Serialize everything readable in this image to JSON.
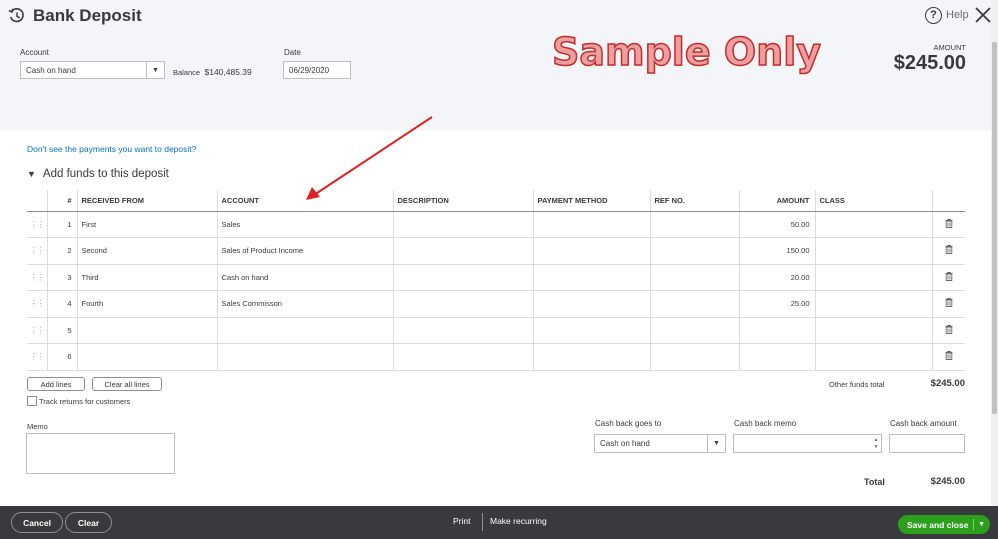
{
  "header": {
    "title": "Bank Deposit",
    "help_label": "Help",
    "account_label": "Account",
    "account_value": "Cash on hand",
    "balance_label": "Balance",
    "balance_value": "$140,485.39",
    "date_label": "Date",
    "date_value": "06/29/2020",
    "watermark": "Sample Only",
    "amount_label": "AMOUNT",
    "amount_value": "$245.00"
  },
  "links": {
    "missing_payments": "Don't see the payments you want to deposit?"
  },
  "section": {
    "title": "Add funds to this deposit"
  },
  "table": {
    "columns": [
      "#",
      "RECEIVED FROM",
      "ACCOUNT",
      "DESCRIPTION",
      "PAYMENT METHOD",
      "REF NO.",
      "AMOUNT",
      "CLASS"
    ],
    "rows": [
      {
        "num": "1",
        "received_from": "First",
        "account": "Sales",
        "description": "",
        "payment_method": "",
        "ref_no": "",
        "amount": "50.00",
        "class": ""
      },
      {
        "num": "2",
        "received_from": "Second",
        "account": "Sales of Product Income",
        "description": "",
        "payment_method": "",
        "ref_no": "",
        "amount": "150.00",
        "class": ""
      },
      {
        "num": "3",
        "received_from": "Third",
        "account": "Cash on hand",
        "description": "",
        "payment_method": "",
        "ref_no": "",
        "amount": "20.00",
        "class": ""
      },
      {
        "num": "4",
        "received_from": "Fourth",
        "account": "Sales Commisson",
        "description": "",
        "payment_method": "",
        "ref_no": "",
        "amount": "25.00",
        "class": ""
      },
      {
        "num": "5",
        "received_from": "",
        "account": "",
        "description": "",
        "payment_method": "",
        "ref_no": "",
        "amount": "",
        "class": ""
      },
      {
        "num": "6",
        "received_from": "",
        "account": "",
        "description": "",
        "payment_method": "",
        "ref_no": "",
        "amount": "",
        "class": ""
      }
    ]
  },
  "actions": {
    "add_lines": "Add lines",
    "clear_all_lines": "Clear all lines",
    "track_returns": "Track returns for customers",
    "other_funds_total_label": "Other funds total",
    "other_funds_total_value": "$245.00"
  },
  "memo": {
    "label": "Memo"
  },
  "cashback": {
    "goes_to_label": "Cash back goes to",
    "goes_to_value": "Cash on hand",
    "memo_label": "Cash back memo",
    "amount_label": "Cash back amount"
  },
  "total": {
    "label": "Total",
    "value": "$245.00"
  },
  "footer": {
    "cancel": "Cancel",
    "clear": "Clear",
    "print": "Print",
    "make_recurring": "Make recurring",
    "save_and_close": "Save and close"
  },
  "colors": {
    "accent_green": "#2ca01c",
    "link_blue": "#0077c5",
    "footer_bg": "#393a3d",
    "watermark_red": "#c92a2a"
  },
  "icons": [
    "history-icon",
    "help-icon",
    "close-icon",
    "drag-handle-icon",
    "trash-icon",
    "dropdown-caret-icon",
    "arrow-annotation"
  ]
}
